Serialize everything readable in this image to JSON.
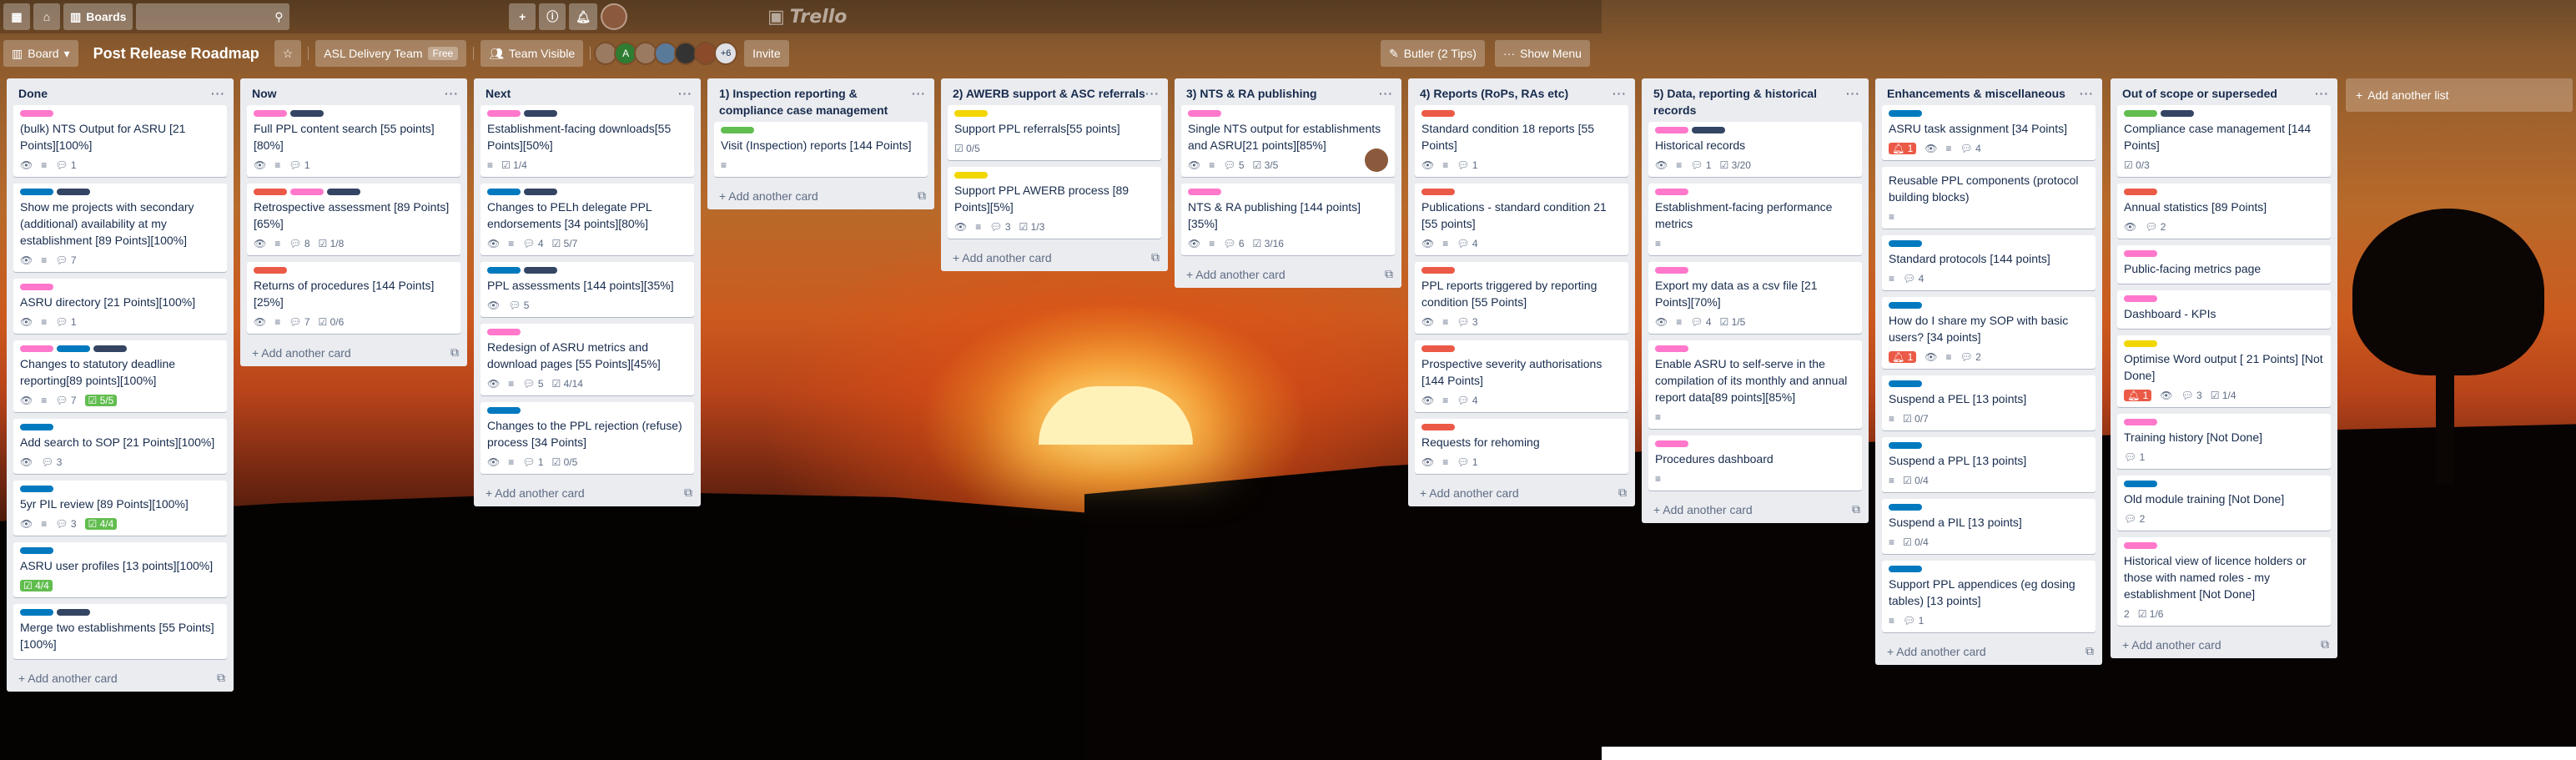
{
  "header": {
    "boards_label": "Boards",
    "logo_text": "Trello"
  },
  "board": {
    "view_label": "Board",
    "title": "Post Release Roadmap",
    "team_label": "ASL Delivery Team",
    "team_badge": "Free",
    "visibility_label": "Team Visible",
    "member_initial": "A",
    "more_members": "+6",
    "invite_label": "Invite",
    "butler_label": "Butler (2 Tips)",
    "menu_label": "Show Menu"
  },
  "add_list_label": "Add another list",
  "add_card_label": "Add another card",
  "lists": [
    {
      "title": "Done",
      "cards": [
        {
          "labels": [
            "pink"
          ],
          "title": "(bulk) NTS Output for ASRU [21 Points][100%]",
          "badges": [
            "eye",
            "desc",
            "c:1"
          ]
        },
        {
          "labels": [
            "blue",
            "black"
          ],
          "title": "Show me projects with secondary (additional) availability at my establishment [89 Points][100%]",
          "badges": [
            "eye",
            "desc",
            "c:7"
          ]
        },
        {
          "labels": [
            "pink"
          ],
          "title": "ASRU directory [21 Points][100%]",
          "badges": [
            "eye",
            "desc",
            "c:1"
          ]
        },
        {
          "labels": [
            "pink",
            "blue",
            "black"
          ],
          "title": "Changes to statutory deadline reporting[89 points][100%]",
          "badges": [
            "eye",
            "desc",
            "c:7",
            "done:5/5"
          ]
        },
        {
          "labels": [
            "blue"
          ],
          "title": "Add search to SOP [21 Points][100%]",
          "badges": [
            "eye",
            "c:3"
          ]
        },
        {
          "labels": [
            "blue"
          ],
          "title": "5yr PIL review [89 Points][100%]",
          "badges": [
            "eye",
            "desc",
            "c:3",
            "done:4/4"
          ]
        },
        {
          "labels": [
            "blue"
          ],
          "title": "ASRU user profiles [13 points][100%]",
          "badges": [
            "done:4/4"
          ]
        },
        {
          "labels": [
            "blue",
            "black"
          ],
          "title": "Merge two establishments [55 Points][100%]",
          "badges": []
        }
      ]
    },
    {
      "title": "Now",
      "cards": [
        {
          "labels": [
            "pink",
            "black"
          ],
          "title": "Full PPL content search [55 points][80%]",
          "badges": [
            "eye",
            "desc",
            "c:1"
          ]
        },
        {
          "labels": [
            "red",
            "pink",
            "black"
          ],
          "title": "Retrospective assessment [89 Points][65%]",
          "badges": [
            "eye",
            "desc",
            "c:8",
            "ck:1/8"
          ]
        },
        {
          "labels": [
            "red"
          ],
          "title": "Returns of procedures [144 Points][25%]",
          "badges": [
            "eye",
            "desc",
            "c:7",
            "ck:0/6"
          ]
        }
      ]
    },
    {
      "title": "Next",
      "cards": [
        {
          "labels": [
            "pink",
            "black"
          ],
          "title": "Establishment-facing downloads[55 Points][50%]",
          "badges": [
            "desc",
            "ck:1/4"
          ]
        },
        {
          "labels": [
            "blue",
            "black"
          ],
          "title": "Changes to PELh delegate PPL endorsements [34 points][80%]",
          "badges": [
            "eye",
            "desc",
            "c:4",
            "ck:5/7"
          ]
        },
        {
          "labels": [
            "blue",
            "black"
          ],
          "title": "PPL assessments [144 points][35%]",
          "badges": [
            "eye",
            "c:5"
          ]
        },
        {
          "labels": [
            "pink"
          ],
          "title": "Redesign of ASRU metrics and download pages [55 Points][45%]",
          "badges": [
            "eye",
            "desc",
            "c:5",
            "ck:4/14"
          ]
        },
        {
          "labels": [
            "blue"
          ],
          "title": "Changes to the PPL rejection (refuse) process [34 Points]",
          "badges": [
            "eye",
            "desc",
            "c:1",
            "ck:0/5"
          ]
        }
      ]
    },
    {
      "title": "1) Inspection reporting & compliance case management",
      "cards": [
        {
          "labels": [
            "green"
          ],
          "title": "Visit (Inspection) reports [144 Points]",
          "badges": [
            "desc"
          ]
        }
      ]
    },
    {
      "title": "2) AWERB support & ASC referrals",
      "cards": [
        {
          "labels": [
            "yellow"
          ],
          "title": "Support PPL referrals[55 points]",
          "badges": [
            "ck:0/5"
          ]
        },
        {
          "labels": [
            "yellow"
          ],
          "title": "Support PPL AWERB process [89 Points][5%]",
          "badges": [
            "eye",
            "desc",
            "c:3",
            "ck:1/3"
          ]
        }
      ]
    },
    {
      "title": "3) NTS & RA publishing",
      "cards": [
        {
          "labels": [
            "pink"
          ],
          "title": "Single NTS output for establishments and ASRU[21 points][85%]",
          "badges": [
            "eye",
            "desc",
            "c:5",
            "ck:3/5"
          ],
          "avatar": true
        },
        {
          "labels": [
            "pink"
          ],
          "title": "NTS & RA publishing [144 points][35%]",
          "badges": [
            "eye",
            "desc",
            "c:6",
            "ck:3/16"
          ]
        }
      ]
    },
    {
      "title": "4) Reports (RoPs, RAs etc)",
      "cards": [
        {
          "labels": [
            "red"
          ],
          "title": "Standard condition 18 reports [55 Points]",
          "badges": [
            "eye",
            "desc",
            "c:1"
          ]
        },
        {
          "labels": [
            "red"
          ],
          "title": "Publications - standard condition 21 [55 points]",
          "badges": [
            "eye",
            "desc",
            "c:4"
          ]
        },
        {
          "labels": [
            "red"
          ],
          "title": "PPL reports triggered by reporting condition [55 Points]",
          "badges": [
            "eye",
            "desc",
            "c:3"
          ]
        },
        {
          "labels": [
            "red"
          ],
          "title": "Prospective severity authorisations [144 Points]",
          "badges": [
            "eye",
            "desc",
            "c:4"
          ]
        },
        {
          "labels": [
            "red"
          ],
          "title": "Requests for rehoming",
          "badges": [
            "eye",
            "desc",
            "c:1"
          ]
        }
      ]
    },
    {
      "title": "5) Data, reporting & historical records",
      "cards": [
        {
          "labels": [
            "pink",
            "black"
          ],
          "title": "Historical records",
          "badges": [
            "eye",
            "desc",
            "c:1",
            "ck:3/20"
          ]
        },
        {
          "labels": [
            "pink"
          ],
          "title": "Establishment-facing performance metrics",
          "badges": [
            "desc"
          ]
        },
        {
          "labels": [
            "pink"
          ],
          "title": "Export my data as a csv file [21 Points][70%]",
          "badges": [
            "eye",
            "desc",
            "c:4",
            "ck:1/5"
          ]
        },
        {
          "labels": [
            "pink"
          ],
          "title": "Enable ASRU to self-serve in the compilation of its monthly and annual report data[89 points][85%]",
          "badges": [
            "desc"
          ]
        },
        {
          "labels": [
            "pink"
          ],
          "title": "Procedures dashboard",
          "badges": [
            "desc"
          ]
        }
      ]
    },
    {
      "title": "Enhancements & miscellaneous",
      "cards": [
        {
          "labels": [
            "blue"
          ],
          "title": "ASRU task assignment [34 Points]",
          "badges": [
            "due:1",
            "eye",
            "desc",
            "c:4"
          ]
        },
        {
          "labels": [],
          "title": "Reusable PPL components (protocol building blocks)",
          "badges": [
            "desc"
          ]
        },
        {
          "labels": [
            "blue"
          ],
          "title": "Standard protocols [144 points]",
          "badges": [
            "desc",
            "c:4"
          ]
        },
        {
          "labels": [
            "blue"
          ],
          "title": "How do I share my SOP with basic users? [34 points]",
          "badges": [
            "due:1",
            "eye",
            "desc",
            "c:2"
          ]
        },
        {
          "labels": [
            "blue"
          ],
          "title": "Suspend a PEL [13 points]",
          "badges": [
            "desc",
            "ck:0/7"
          ]
        },
        {
          "labels": [
            "blue"
          ],
          "title": "Suspend a PPL [13 points]",
          "badges": [
            "desc",
            "ck:0/4"
          ]
        },
        {
          "labels": [
            "blue"
          ],
          "title": "Suspend a PIL [13 points]",
          "badges": [
            "desc",
            "ck:0/4"
          ]
        },
        {
          "labels": [
            "blue"
          ],
          "title": "Support PPL appendices (eg dosing tables) [13 points]",
          "badges": [
            "desc",
            "c:1"
          ]
        }
      ]
    },
    {
      "title": "Out of scope or superseded",
      "cards": [
        {
          "labels": [
            "green",
            "black"
          ],
          "title": "Compliance case management [144 Points]",
          "badges": [
            "ck:0/3"
          ]
        },
        {
          "labels": [
            "red"
          ],
          "title": "Annual statistics [89 Points]",
          "badges": [
            "eye",
            "c:2"
          ]
        },
        {
          "labels": [
            "pink"
          ],
          "title": "Public-facing metrics page",
          "badges": []
        },
        {
          "labels": [
            "pink"
          ],
          "title": "Dashboard - KPIs",
          "badges": []
        },
        {
          "labels": [
            "yellow"
          ],
          "title": "Optimise Word output [ 21 Points] [Not Done]",
          "badges": [
            "due:1",
            "eye",
            "c:3",
            "ck:1/4"
          ]
        },
        {
          "labels": [
            "pink"
          ],
          "title": "Training history [Not Done]",
          "badges": [
            "c:1"
          ]
        },
        {
          "labels": [
            "blue"
          ],
          "title": "Old module training [Not Done]",
          "badges": [
            "c:2"
          ]
        },
        {
          "labels": [
            "pink"
          ],
          "title": "Historical view of licence holders or those with named roles - my establishment [Not Done]",
          "badges": [
            "n:2",
            "ck:1/6"
          ]
        }
      ]
    }
  ]
}
